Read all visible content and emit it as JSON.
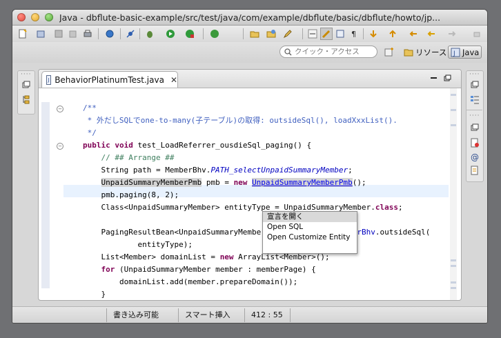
{
  "window": {
    "title": "Java - dbflute-basic-example/src/test/java/com/example/dbflute/basic/dbflute/howto/jp..."
  },
  "search": {
    "placeholder": "クイック・アクセス"
  },
  "perspectives": {
    "resource": "リソース",
    "java": "Java"
  },
  "editor": {
    "tab_title": "BehaviorPlatinumTest.java",
    "code_lines": [
      "/**",
      " * 外だしSQLでone-to-many(子テーブル)の取得: outsideSql(), loadXxxList().",
      " */",
      "public void test_LoadReferrer_ousdieSql_paging() {",
      "    // ## Arrange ##",
      "    String path = MemberBhv.PATH_selectUnpaidSummaryMember;",
      "    UnpaidSummaryMemberPmb pmb = new UnpaidSummaryMemberPmb();",
      "    pmb.paging(8, 2);",
      "    Class<UnpaidSummaryMember> entityType = UnpaidSummaryMember.class;",
      "",
      "    PagingResultBean<UnpaidSummaryMember> memberPage = memberBhv.outsideSql(",
      "            entityType);",
      "    List<Member> domainList = new ArrayList<Member>();",
      "    for (UnpaidSummaryMember member : memberPage) {",
      "        domainList.add(member.prepareDomain());",
      "    }"
    ]
  },
  "context_menu": {
    "items": [
      "宣言を開く",
      "Open SQL",
      "Open Customize Entity"
    ]
  },
  "status": {
    "writable": "書き込み可能",
    "insert_mode": "スマート挿入",
    "position": "412 : 55"
  }
}
